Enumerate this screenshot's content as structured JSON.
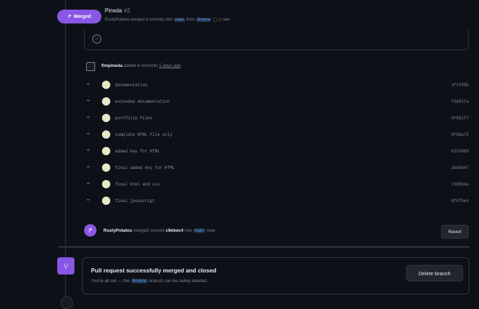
{
  "header": {
    "merged_label": "Merged",
    "merged_icon": "merge-icon",
    "pr_title": "Pineda",
    "pr_number": "#2",
    "author": "RustyPotatos",
    "merge_text": "merged 8 commits into",
    "base_branch": "main",
    "from_text": "from",
    "head_branch": "fimpine",
    "comment_count": "1 new"
  },
  "commits_header": {
    "author": "fimpineda",
    "text": "added 8 commits",
    "time": "5 days ago"
  },
  "commits": [
    {
      "message": "documentation",
      "sha": "3f1f89b"
    },
    {
      "message": "extended documentation",
      "sha": "f3d017a"
    },
    {
      "message": "portfolio files",
      "sha": "0f8b1f7"
    },
    {
      "message": "complete HTML file only",
      "sha": "0f0ba75"
    },
    {
      "message": "added key for HTML",
      "sha": "637d986"
    },
    {
      "message": "final added key for HTML",
      "sha": "2be5d47"
    },
    {
      "message": "final html and css",
      "sha": "7185bde"
    },
    {
      "message": "final javascript",
      "sha": "0f8f5e4"
    }
  ],
  "merge_event": {
    "author": "RustyPotatos",
    "text": "merged commit",
    "commit": "c9ebec4",
    "into_text": "into",
    "branch": "main",
    "time": "now",
    "revert_label": "Revert"
  },
  "merged_status": {
    "title": "Pull request successfully merged and closed",
    "desc_prefix": "You're all set — the",
    "branch": "fimpine",
    "desc_suffix": "branch can be safely deleted.",
    "delete_label": "Delete branch"
  },
  "colors": {
    "background": "#0d1117",
    "merged_purple": "#8957e5",
    "link_blue": "#58a6ff",
    "border": "#30363d",
    "avatar": "#e6e8c8"
  }
}
